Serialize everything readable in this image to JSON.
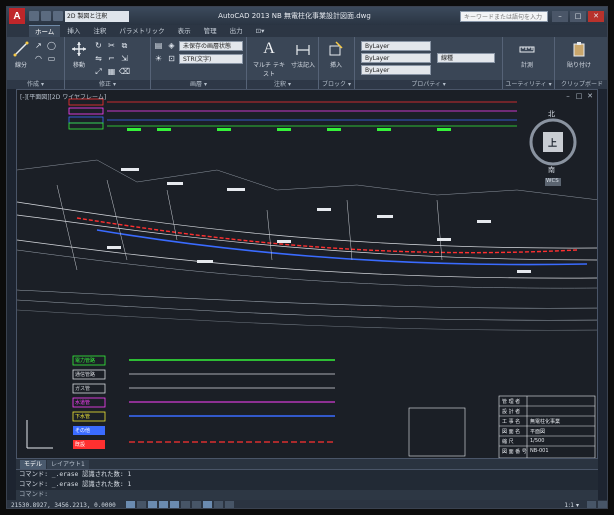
{
  "window": {
    "app_logo": "A",
    "workspace": "2D 製図と注釈",
    "title": "AutoCAD 2013   NB 無電柱化事業設計図面.dwg",
    "search_placeholder": "キーワードまたは語句を入力",
    "controls": {
      "minimize": "–",
      "maximize": "□",
      "close": "✕"
    }
  },
  "ribbon": {
    "tabs": [
      "ホーム",
      "挿入",
      "注釈",
      "パラメトリック",
      "表示",
      "管理",
      "出力",
      "⊡▾"
    ],
    "active_tab": "ホーム",
    "panels": {
      "draw": {
        "title": "作成 ▾",
        "line_label": "線分",
        "polyline_label": "ポリライン"
      },
      "modify": {
        "title": "修正 ▾",
        "move_label": "移動"
      },
      "annotation": {
        "title": "注釈 ▾",
        "text_label": "マルチ テキスト",
        "dim_label": "寸法記入"
      },
      "layers": {
        "title": "画層 ▾",
        "layer_state": "未保存の画層状態",
        "current_layer": "STR(文字)"
      },
      "block": {
        "title": "ブロック ▾",
        "insert_label": "挿入"
      },
      "properties": {
        "title": "プロパティ ▾",
        "color": "ByLayer",
        "linetype": "ByLayer",
        "lineweight": "ByLayer",
        "style": "線種"
      },
      "utilities": {
        "title": "ユーティリティ ▾",
        "measure_label": "計測"
      },
      "clipboard": {
        "title": "クリップボード",
        "paste_label": "貼り付け"
      }
    }
  },
  "canvas": {
    "viewport_label": "[-][平面図][2D ワイヤフレーム]",
    "viewcube": {
      "north": "北",
      "south": "南",
      "face": "上",
      "wcs": "WCS"
    },
    "legend_labels": [
      "電力管路",
      "通信管路",
      "ガス管",
      "水道管",
      "下水管",
      "その他",
      "既設"
    ],
    "table_labels": [
      "管 理 者",
      "設 計 者",
      "工 事 名",
      "図 面 名",
      "縮 尺",
      "図 面 番 号"
    ],
    "table_values": [
      "",
      "",
      "無電柱化事業",
      "平面図",
      "1/500",
      "NB-001"
    ]
  },
  "layout_tabs": [
    "モデル",
    "レイアウト1"
  ],
  "command_line": {
    "history": [
      "コマンド: _.erase 認識された数: 1",
      "コマンド: _.erase 認識された数: 1"
    ],
    "prompt": "コマンド:"
  },
  "statusbar": {
    "coordinates": "21530.8927, 3456.2213, 0.0000",
    "scale": "1:1 ▾"
  },
  "colors": {
    "accent": "#6b8bb0",
    "drawing_bg": "#1b1f26",
    "cad_green": "#35f23a",
    "cad_red": "#ff3030",
    "cad_magenta": "#ff40ff",
    "cad_blue": "#3a6bff",
    "cad_yellow": "#f2e836"
  }
}
